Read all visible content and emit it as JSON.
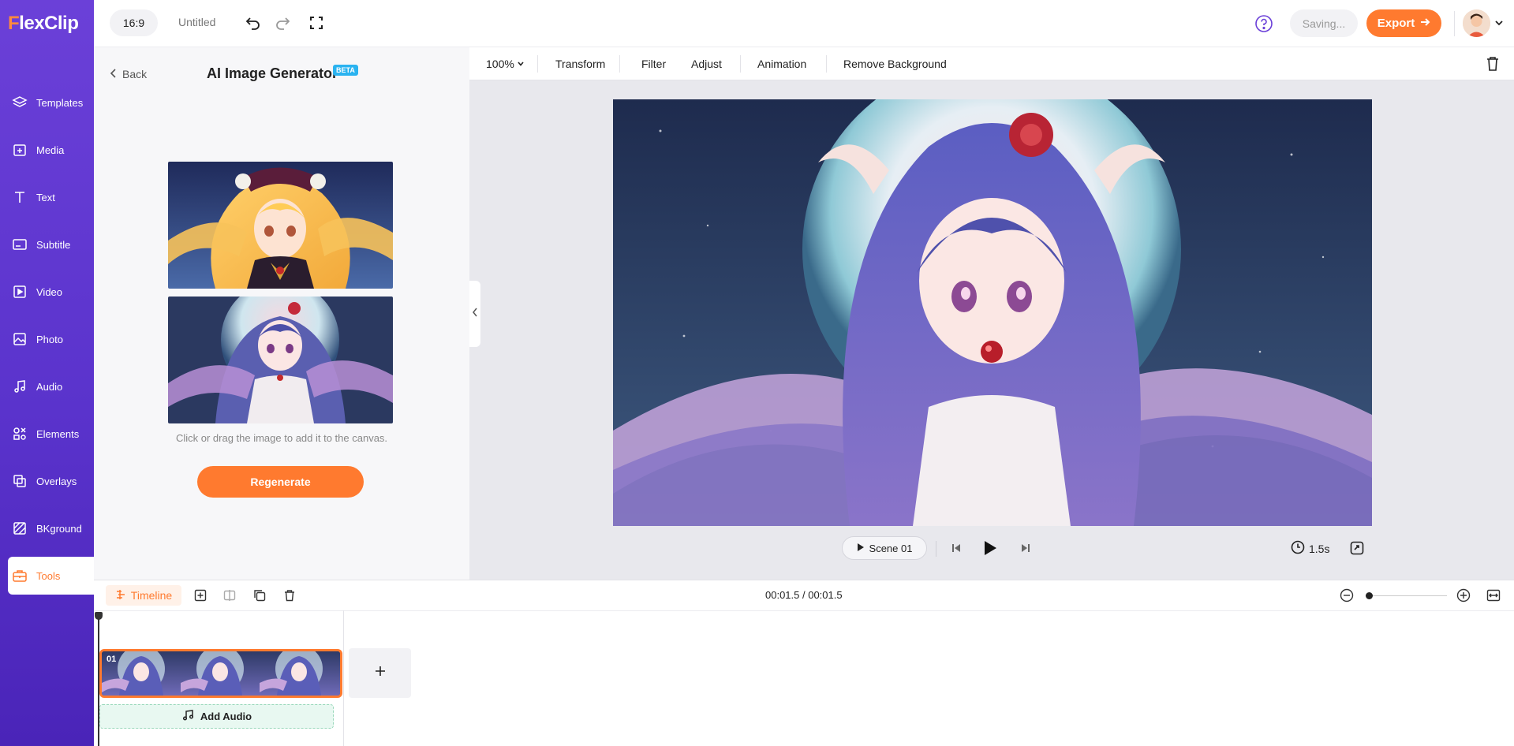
{
  "app": {
    "logo_rest": "lexClip",
    "logo_f": "F"
  },
  "sidebar": {
    "items": [
      {
        "label": "Templates",
        "icon": "layers-icon"
      },
      {
        "label": "Media",
        "icon": "media-upload-icon"
      },
      {
        "label": "Text",
        "icon": "text-icon"
      },
      {
        "label": "Subtitle",
        "icon": "subtitle-icon"
      },
      {
        "label": "Video",
        "icon": "video-icon"
      },
      {
        "label": "Photo",
        "icon": "photo-icon"
      },
      {
        "label": "Audio",
        "icon": "music-note-icon"
      },
      {
        "label": "Elements",
        "icon": "elements-icon"
      },
      {
        "label": "Overlays",
        "icon": "overlays-icon"
      },
      {
        "label": "BKground",
        "icon": "background-icon"
      },
      {
        "label": "Tools",
        "icon": "toolbox-icon",
        "active": true
      }
    ]
  },
  "topbar": {
    "ratio": "16:9",
    "title": "Untitled",
    "saving": "Saving...",
    "export": "Export"
  },
  "panel": {
    "back": "Back",
    "title": "AI Image Generator",
    "badge": "BETA",
    "hint": "Click or drag the image to add it to the canvas.",
    "regenerate": "Regenerate"
  },
  "editor_toolbar": {
    "zoom": "100%",
    "transform": "Transform",
    "filter": "Filter",
    "adjust": "Adjust",
    "animation": "Animation",
    "remove_bg": "Remove Background"
  },
  "playback": {
    "scene": "Scene 01",
    "duration": "1.5s"
  },
  "timeline": {
    "label": "Timeline",
    "timecode": "00:01.5 / 00:01.5",
    "clip_number": "01",
    "add_audio": "Add Audio"
  },
  "colors": {
    "brand_purple": "#5a33cc",
    "accent_orange": "#ff7a2f",
    "beta_blue": "#2ab3f0"
  }
}
